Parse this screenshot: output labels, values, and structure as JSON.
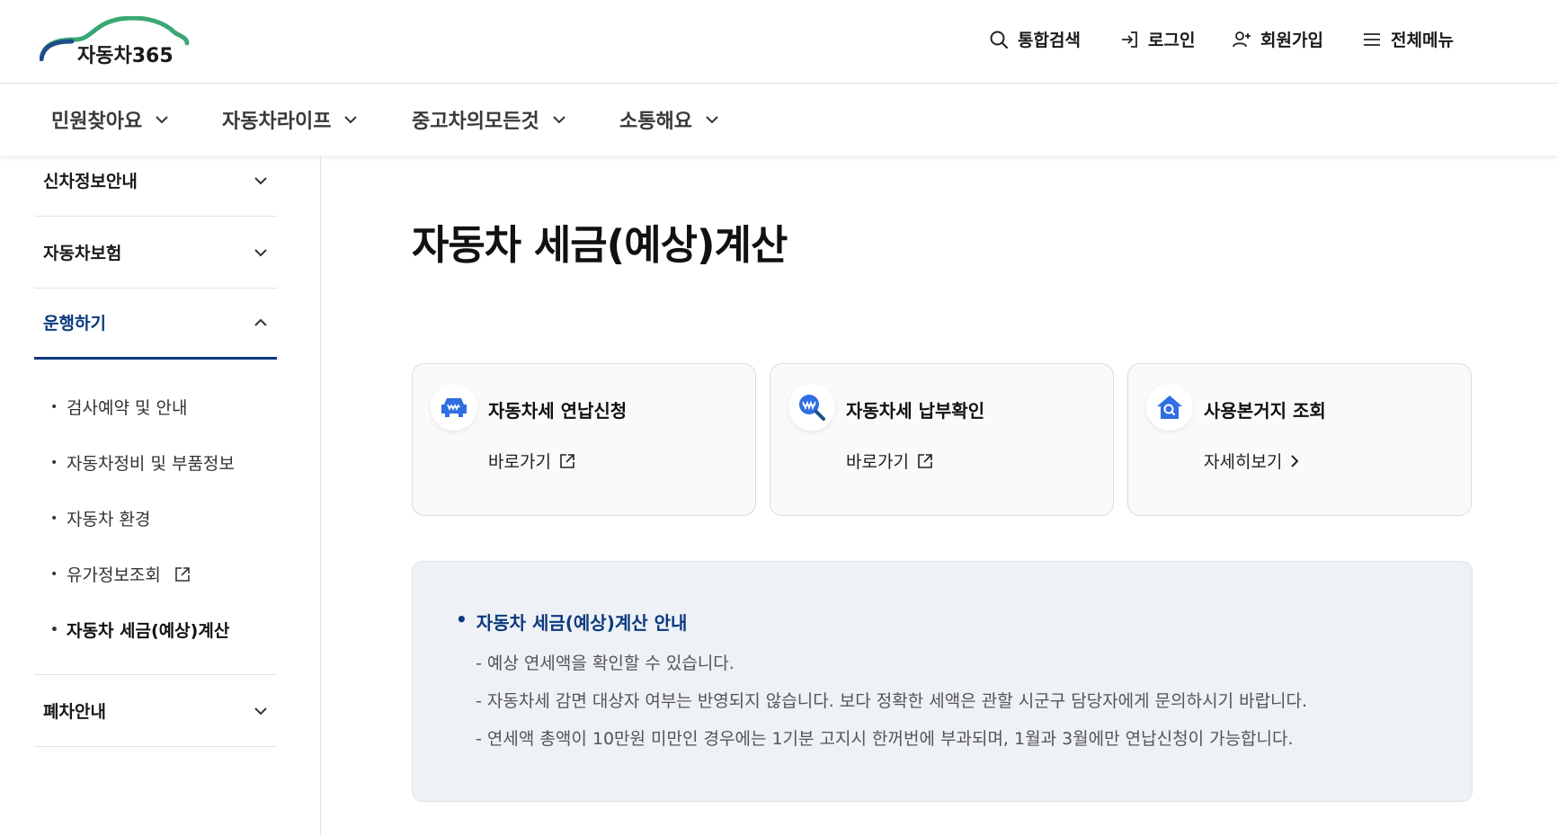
{
  "brand": {
    "logo_text": "자동차365"
  },
  "util_menu": {
    "search": "통합검색",
    "login": "로그인",
    "signup": "회원가입",
    "all_menu": "전체메뉴"
  },
  "gnb": [
    "민원찾아요",
    "자동차라이프",
    "중고차의모든것",
    "소통해요"
  ],
  "sidebar": {
    "sections": [
      "신차정보안내",
      "자동차보험",
      "운행하기",
      "폐차안내"
    ],
    "active_section": "운행하기",
    "sub_items": [
      "검사예약 및 안내",
      "자동차정비 및 부품정보",
      "자동차 환경",
      "유가정보조회",
      "자동차 세금(예상)계산"
    ],
    "current_sub_item": "자동차 세금(예상)계산"
  },
  "page_title": "자동차 세금(예상)계산",
  "cards": [
    {
      "title": "자동차세 연납신청",
      "link": "바로가기",
      "icon": "car-won-icon",
      "link_icon": "external-link-icon"
    },
    {
      "title": "자동차세 납부확인",
      "link": "바로가기",
      "icon": "won-search-icon",
      "link_icon": "external-link-icon"
    },
    {
      "title": "사용본거지 조회",
      "link": "자세히보기",
      "icon": "home-search-icon",
      "link_icon": "chevron-right-icon"
    }
  ],
  "info": {
    "title": "자동차 세금(예상)계산 안내",
    "lines": [
      "- 예상 연세액을 확인할 수 있습니다.",
      "- 자동차세 감면 대상자 여부는 반영되지 않습니다. 보다 정확한 세액은 관할 시군구 담당자에게 문의하시기 바랍니다.",
      "- 연세액 총액이 10만원 미만인 경우에는 1기분 고지시 한꺼번에 부과되며, 1월과 3월에만 연납신청이 가능합니다."
    ]
  },
  "colors": {
    "accent": "#0b3a7e",
    "icon_blue": "#2f6fe0",
    "logo_green": "#2e8b57",
    "logo_blue": "#1e6fb8"
  }
}
